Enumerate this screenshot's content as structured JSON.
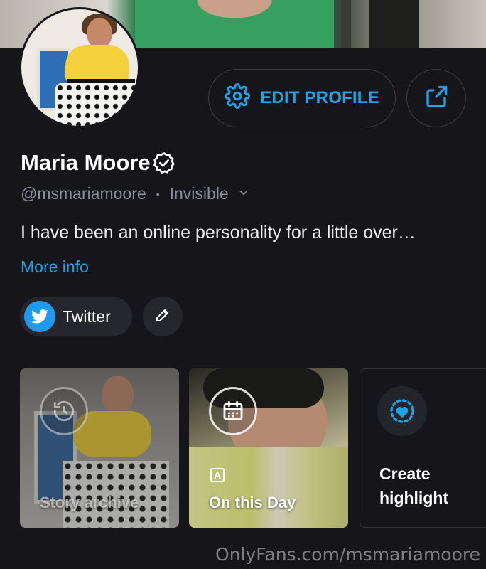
{
  "profile": {
    "edit_label": "EDIT PROFILE",
    "name": "Maria Moore",
    "handle": "@msmariamoore",
    "status": "Invisible",
    "bio": "I have been an online personality for a little over…",
    "more_info": "More info"
  },
  "links": {
    "twitter_label": "Twitter"
  },
  "highlights": [
    {
      "label": "Story archive",
      "icon": "history-icon"
    },
    {
      "label": "On this Day",
      "icon": "calendar-icon"
    },
    {
      "label": "Create highlight",
      "icon": "heart-circle-icon"
    }
  ],
  "watermark": "OnlyFans.com/msmariamoore",
  "colors": {
    "accent": "#1fa3e8",
    "background": "#16161a",
    "twitter": "#1d9bf0"
  }
}
